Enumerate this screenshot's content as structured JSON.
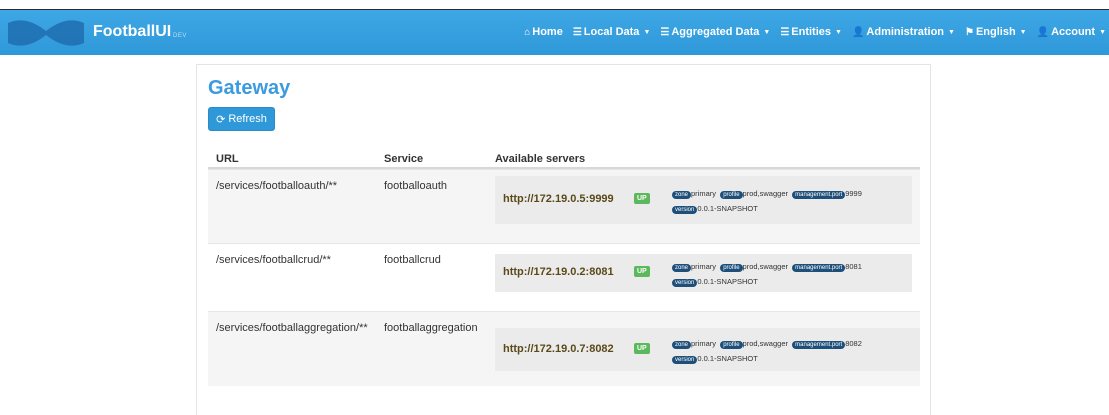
{
  "app": {
    "name": "FootballUI",
    "env": "DEV"
  },
  "nav": [
    {
      "label": "Home",
      "icon": "home-icon",
      "glyph": "⌂",
      "dropdown": false
    },
    {
      "label": "Local Data",
      "icon": "list-icon",
      "glyph": "☰",
      "dropdown": true
    },
    {
      "label": "Aggregated Data",
      "icon": "list-icon",
      "glyph": "☰",
      "dropdown": true
    },
    {
      "label": "Entities",
      "icon": "list-icon",
      "glyph": "☰",
      "dropdown": true
    },
    {
      "label": "Administration",
      "icon": "user-plus-icon",
      "glyph": "👤",
      "dropdown": true
    },
    {
      "label": "English",
      "icon": "flag-icon",
      "glyph": "⚑",
      "dropdown": true
    },
    {
      "label": "Account",
      "icon": "user-icon",
      "glyph": "👤",
      "dropdown": true
    }
  ],
  "page": {
    "title": "Gateway",
    "refresh_label": "Refresh"
  },
  "table": {
    "headers": {
      "url": "URL",
      "service": "Service",
      "servers": "Available servers"
    },
    "rows": [
      {
        "url": "/services/footballoauth/**",
        "service": "footballoauth",
        "server": "http://172.19.0.5:9999",
        "status": "UP",
        "zone_label": "zone",
        "zone": "primary",
        "profile_label": "profile",
        "profile": "prod,swagger",
        "port_label": "management.port",
        "port": "9999",
        "version_label": "version",
        "version": "0.0.1-SNAPSHOT"
      },
      {
        "url": "/services/footballcrud/**",
        "service": "footballcrud",
        "server": "http://172.19.0.2:8081",
        "status": "UP",
        "zone_label": "zone",
        "zone": "primary",
        "profile_label": "profile",
        "profile": "prod,swagger",
        "port_label": "management.port",
        "port": "8081",
        "version_label": "version",
        "version": "0.0.1-SNAPSHOT"
      },
      {
        "url": "/services/footballaggregation/**",
        "service": "footballaggregation",
        "server": "http://172.19.0.7:8082",
        "status": "UP",
        "zone_label": "zone",
        "zone": "primary",
        "profile_label": "profile",
        "profile": "prod,swagger",
        "port_label": "management.port",
        "port": "8082",
        "version_label": "version",
        "version": "0.0.1-SNAPSHOT"
      }
    ]
  },
  "colors": {
    "navbar": "#2f98d8",
    "title": "#3a9be0",
    "up_badge": "#5cb85c",
    "meta_label": "#1d4f7a"
  }
}
